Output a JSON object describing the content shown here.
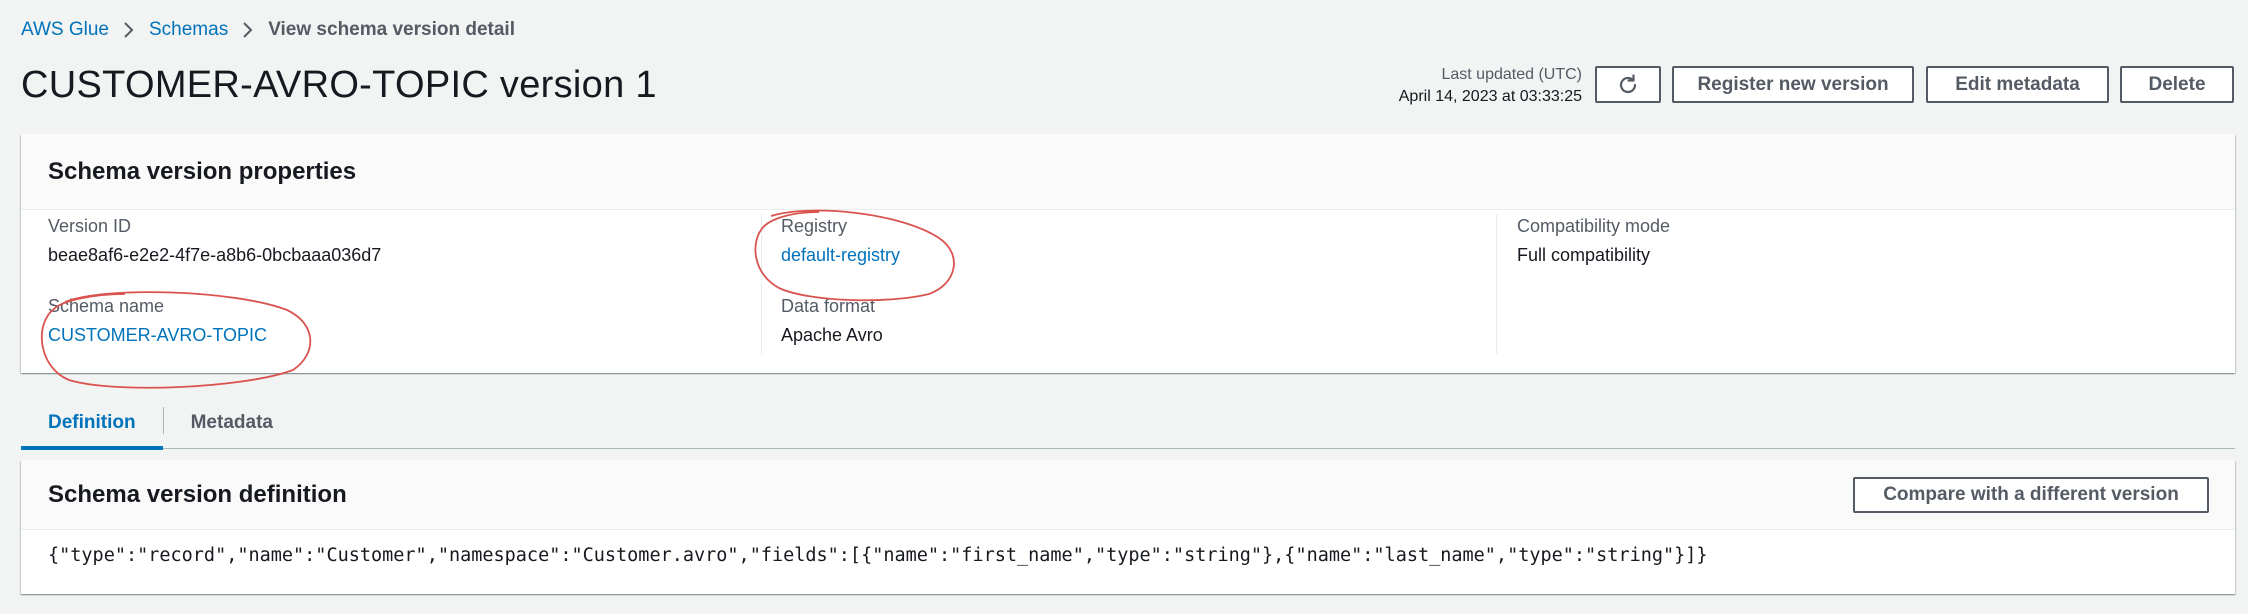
{
  "breadcrumb": {
    "items": [
      {
        "label": "AWS Glue"
      },
      {
        "label": "Schemas"
      }
    ],
    "current": "View schema version detail"
  },
  "page": {
    "title": "CUSTOMER-AVRO-TOPIC version 1",
    "last_updated_label": "Last updated (UTC)",
    "last_updated_value": "April 14, 2023 at 03:33:25"
  },
  "actions": {
    "refresh_icon": "refresh-icon",
    "register_label": "Register new version",
    "edit_label": "Edit metadata",
    "delete_label": "Delete"
  },
  "properties": {
    "title": "Schema version properties",
    "version_id": {
      "label": "Version ID",
      "value": "beae8af6-e2e2-4f7e-a8b6-0bcbaaa036d7"
    },
    "schema_name": {
      "label": "Schema name",
      "value": "CUSTOMER-AVRO-TOPIC"
    },
    "registry": {
      "label": "Registry",
      "value": "default-registry"
    },
    "data_format": {
      "label": "Data format",
      "value": "Apache Avro"
    },
    "compatibility": {
      "label": "Compatibility mode",
      "value": "Full compatibility"
    }
  },
  "tabs": [
    {
      "label": "Definition",
      "active": true
    },
    {
      "label": "Metadata",
      "active": false
    }
  ],
  "definition": {
    "title": "Schema version definition",
    "compare_label": "Compare with a different version",
    "body": "{\"type\":\"record\",\"name\":\"Customer\",\"namespace\":\"Customer.avro\",\"fields\":[{\"name\":\"first_name\",\"type\":\"string\"},{\"name\":\"last_name\",\"type\":\"string\"}]}"
  },
  "colors": {
    "link": "#0073bb",
    "annotation": "#d9534f",
    "background": "#f2f3f3"
  }
}
